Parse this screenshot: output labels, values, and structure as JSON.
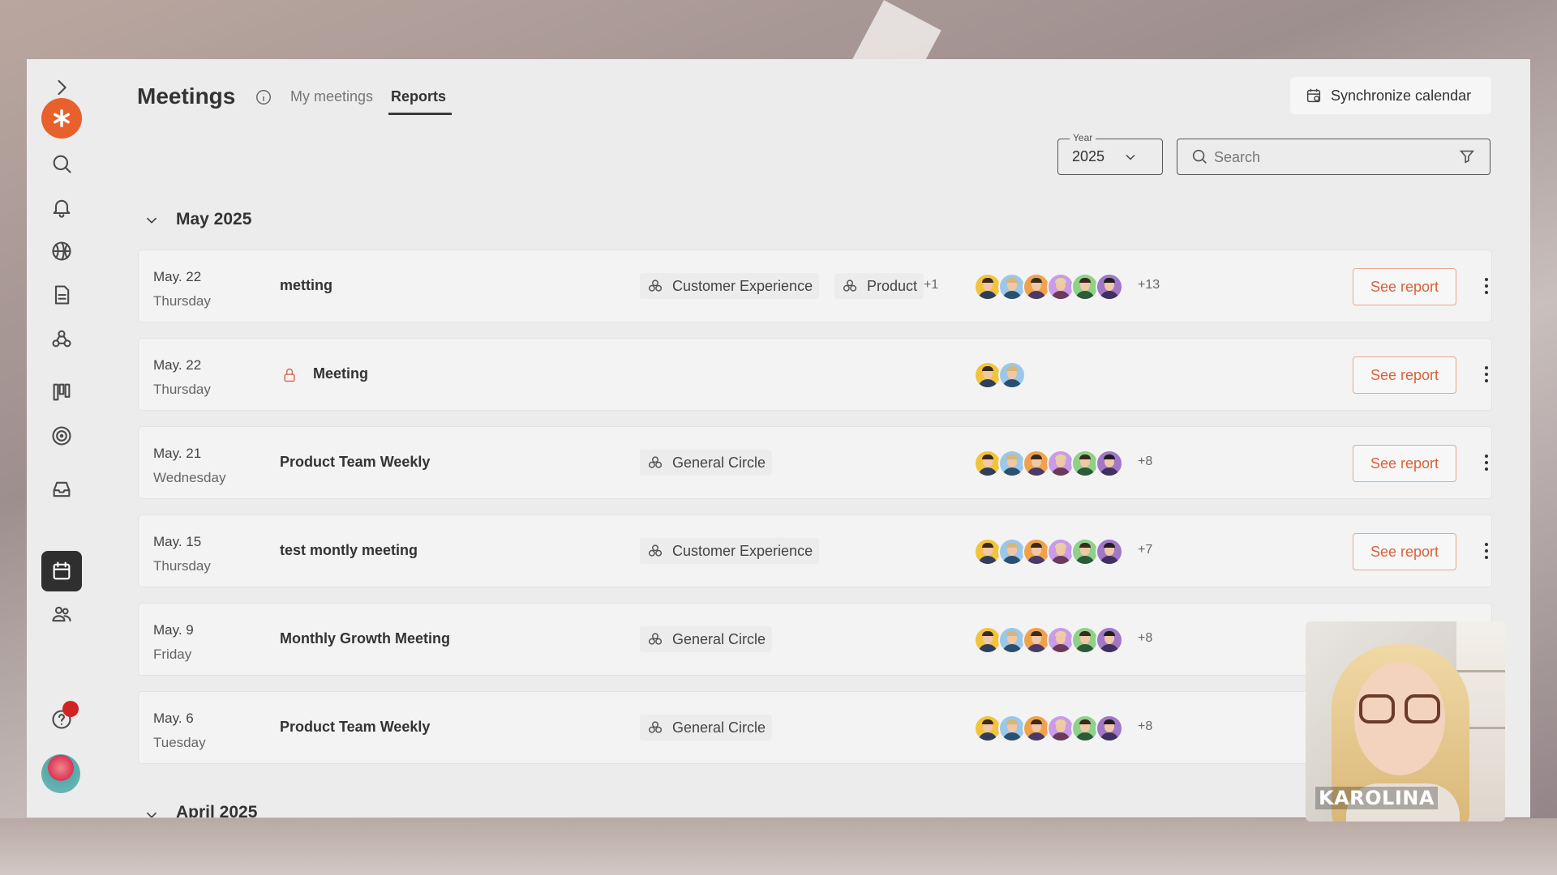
{
  "app": {
    "page_title": "Meetings",
    "tabs": [
      {
        "label": "My meetings",
        "active": false
      },
      {
        "label": "Reports",
        "active": true
      }
    ],
    "sync_button": "Synchronize calendar",
    "year_label": "Year",
    "year_value": "2025",
    "search_placeholder": "Search"
  },
  "sidebar": {
    "icons": [
      "chevron-right-icon",
      "logo-icon",
      "search-icon",
      "bell-icon",
      "basketball-icon",
      "document-icon",
      "circles-icon",
      "kanban-icon",
      "target-icon",
      "inbox-icon",
      "calendar-icon",
      "users-icon",
      "help-icon",
      "user-avatar"
    ],
    "active": "calendar-icon",
    "help_badge": true
  },
  "sections": [
    {
      "title": "May 2025",
      "meetings": [
        {
          "date": "May. 22",
          "day": "Thursday",
          "title": "metting",
          "locked": false,
          "circles": [
            "Customer Experience",
            "Product"
          ],
          "more_circles": "+1",
          "avatar_count": 6,
          "more_participants": "+13",
          "action": "See report"
        },
        {
          "date": "May. 22",
          "day": "Thursday",
          "title": "Meeting",
          "locked": true,
          "circles": [],
          "more_circles": "",
          "avatar_count": 2,
          "more_participants": "",
          "action": "See report"
        },
        {
          "date": "May. 21",
          "day": "Wednesday",
          "title": "Product Team Weekly",
          "locked": false,
          "circles": [
            "General Circle"
          ],
          "more_circles": "",
          "avatar_count": 6,
          "more_participants": "+8",
          "action": "See report"
        },
        {
          "date": "May. 15",
          "day": "Thursday",
          "title": "test montly meeting",
          "locked": false,
          "circles": [
            "Customer Experience"
          ],
          "more_circles": "",
          "avatar_count": 6,
          "more_participants": "+7",
          "action": "See report"
        },
        {
          "date": "May. 9",
          "day": "Friday",
          "title": "Monthly Growth Meeting",
          "locked": false,
          "circles": [
            "General Circle"
          ],
          "more_circles": "",
          "avatar_count": 6,
          "more_participants": "+8",
          "action": ""
        },
        {
          "date": "May. 6",
          "day": "Tuesday",
          "title": "Product Team Weekly",
          "locked": false,
          "circles": [
            "General Circle"
          ],
          "more_circles": "",
          "avatar_count": 6,
          "more_participants": "+8",
          "action": ""
        }
      ]
    },
    {
      "title": "April 2025",
      "meetings": []
    }
  ],
  "video_overlay": {
    "name": "KAROLINA"
  },
  "colors": {
    "accent": "#e8602c",
    "report_text": "#d9613a",
    "report_border": "#e5a98f",
    "active_sidebar": "#2f2f2f"
  }
}
